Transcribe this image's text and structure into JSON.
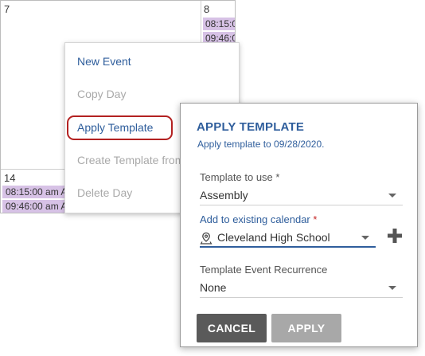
{
  "calendar": {
    "days": [
      {
        "number": "7",
        "events": []
      },
      {
        "number": "8",
        "events": [
          "08:15:0",
          "09:46:0"
        ]
      },
      {
        "number": "14",
        "events": [
          "08:15:00 am A",
          "09:46:00 am A"
        ]
      }
    ]
  },
  "context_menu": {
    "items": [
      {
        "label": "New Event",
        "state": "enabled"
      },
      {
        "label": "Copy Day",
        "state": "disabled"
      },
      {
        "label": "Apply Template",
        "state": "enabled"
      },
      {
        "label": "Create Template from",
        "state": "disabled"
      },
      {
        "label": "Delete Day",
        "state": "disabled"
      }
    ]
  },
  "dialog": {
    "title": "APPLY TEMPLATE",
    "subtitle": "Apply template to 09/28/2020.",
    "template_field": {
      "label": "Template to use",
      "required_mark": "*",
      "value": "Assembly"
    },
    "calendar_field": {
      "label": "Add to existing calendar",
      "required_mark": "*",
      "value": "Cleveland High School",
      "icon": "map-pin-icon"
    },
    "recurrence_field": {
      "label": "Template Event Recurrence",
      "value": "None"
    },
    "cancel_label": "CANCEL",
    "apply_label": "APPLY"
  },
  "colors": {
    "accent": "#2f5e9c",
    "event_bg": "#d7c2e6",
    "highlight_ring": "#b32121",
    "required": "#c62828",
    "cancel_bg": "#5a5a5a",
    "apply_bg": "#a8a8a8"
  }
}
